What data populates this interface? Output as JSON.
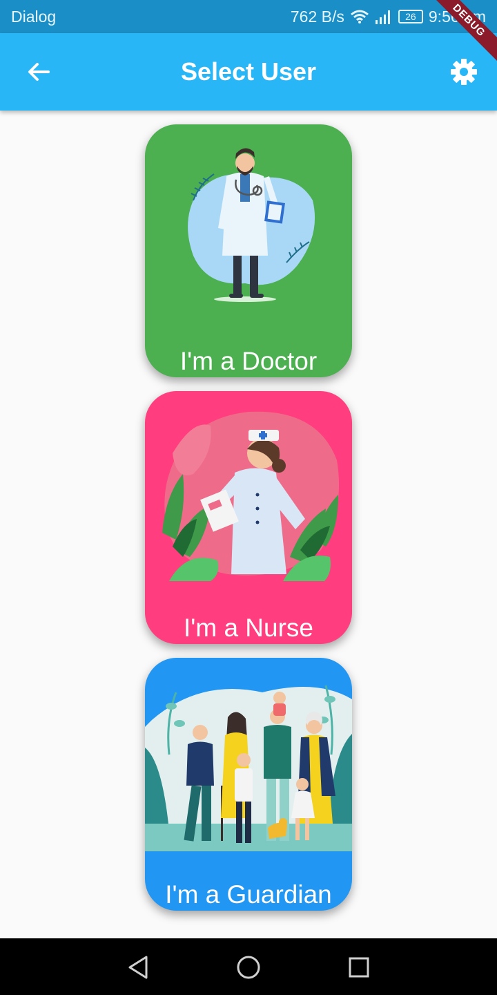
{
  "status_bar": {
    "app_name": "Dialog",
    "network_speed": "762 B/s",
    "battery": "26",
    "time": "9:56 am"
  },
  "app_bar": {
    "title": "Select User",
    "back_icon": "arrow-back-icon",
    "settings_icon": "settings-gear-icon"
  },
  "debug_banner": "DEBUG",
  "cards": [
    {
      "label": "I'm a Doctor",
      "color": "#4caf50"
    },
    {
      "label": "I'm a Nurse",
      "color": "#ff3d7f"
    },
    {
      "label": "I'm a Guardian",
      "color": "#2196f3"
    }
  ],
  "nav": {
    "back": "triangle-back-icon",
    "home": "circle-home-icon",
    "recents": "square-recents-icon"
  }
}
